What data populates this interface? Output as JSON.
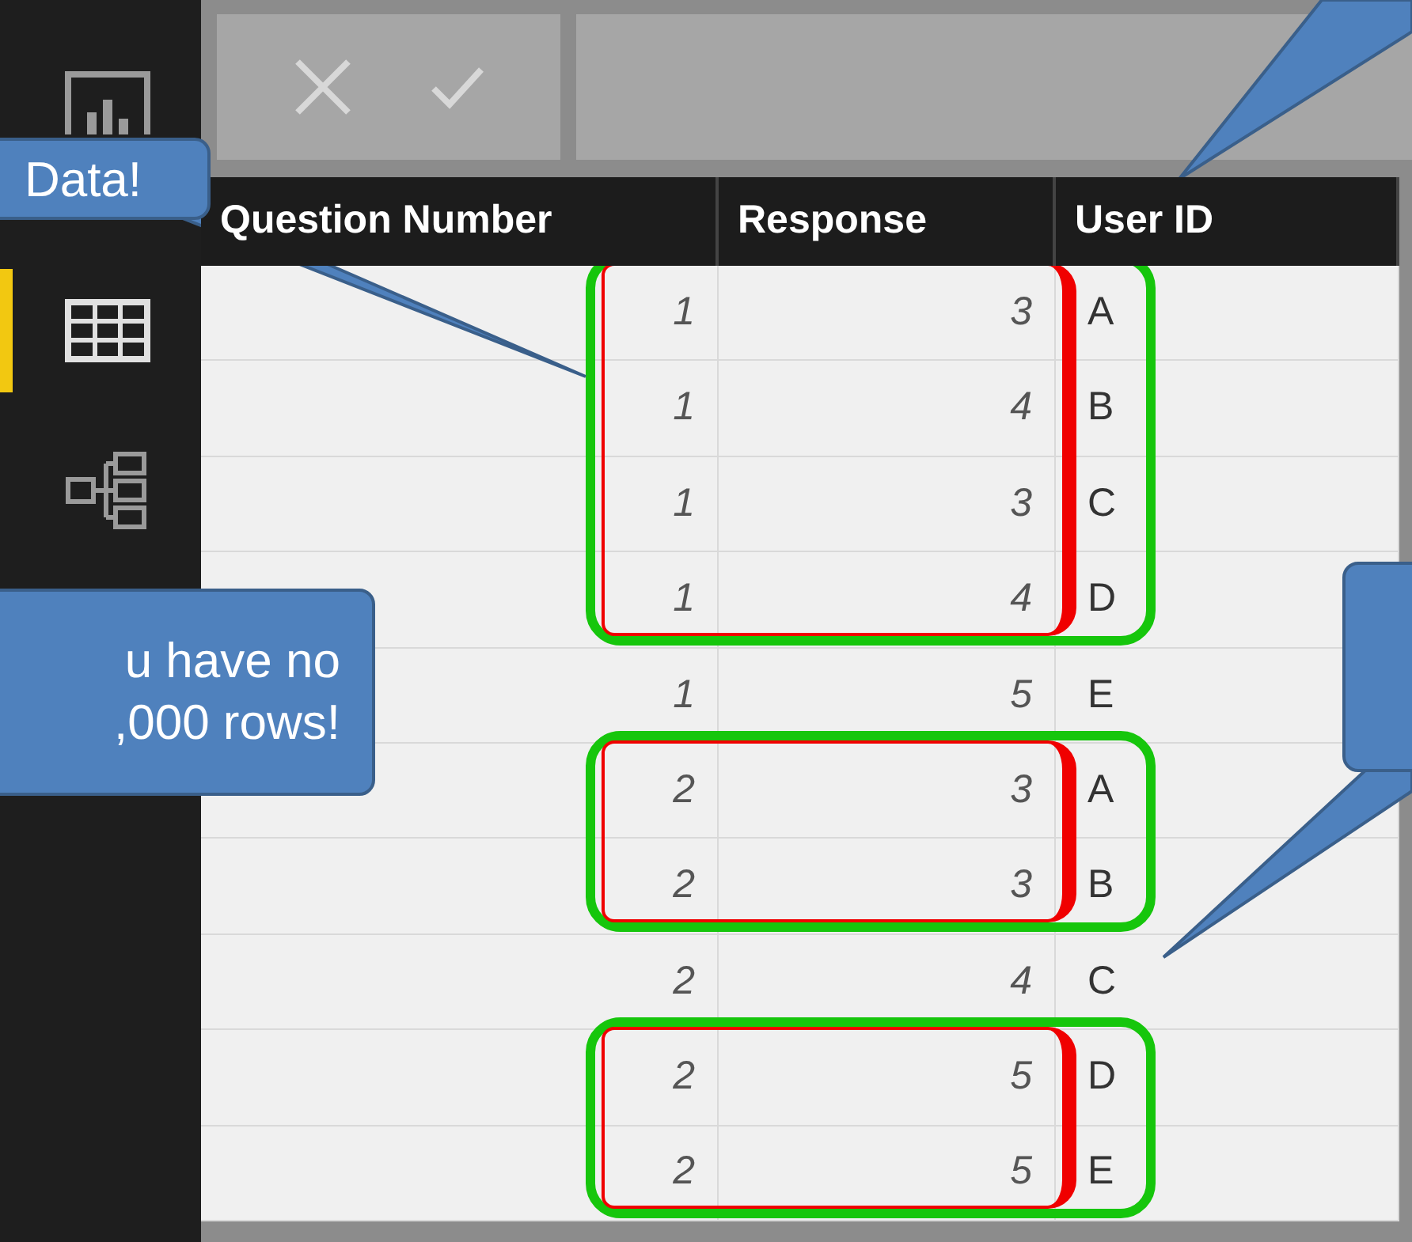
{
  "sidebar": {
    "items": [
      {
        "kind": "report",
        "selected": false
      },
      {
        "kind": "table",
        "selected": true
      },
      {
        "kind": "model",
        "selected": false
      }
    ]
  },
  "table": {
    "columns": [
      "Question Number",
      "Response",
      "User ID"
    ],
    "rows": [
      {
        "cells": [
          "1",
          "3",
          "A"
        ],
        "highlighted": true
      },
      {
        "cells": [
          "1",
          "4",
          "B"
        ],
        "highlighted": true
      },
      {
        "cells": [
          "1",
          "3",
          "C"
        ],
        "highlighted": true
      },
      {
        "cells": [
          "1",
          "4",
          "D"
        ],
        "highlighted": true
      },
      {
        "cells": [
          "1",
          "5",
          "E"
        ],
        "highlighted": false
      },
      {
        "cells": [
          "2",
          "3",
          "A"
        ],
        "highlighted": true
      },
      {
        "cells": [
          "2",
          "3",
          "B"
        ],
        "highlighted": true
      },
      {
        "cells": [
          "2",
          "4",
          "C"
        ],
        "highlighted": false
      },
      {
        "cells": [
          "2",
          "5",
          "D"
        ],
        "highlighted": true
      },
      {
        "cells": [
          "2",
          "5",
          "E"
        ],
        "highlighted": true
      }
    ]
  },
  "callouts": [
    {
      "lines": [
        "Data!"
      ]
    },
    {
      "lines": [
        "u have no",
        ",000 rows!"
      ]
    }
  ]
}
